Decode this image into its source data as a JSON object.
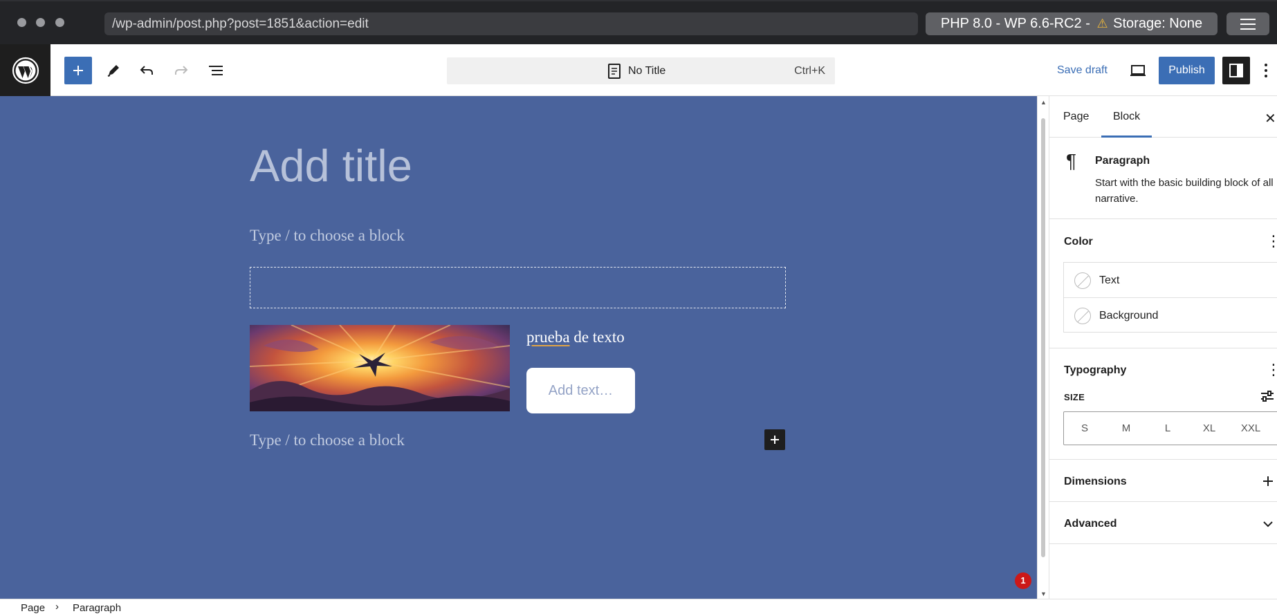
{
  "browser": {
    "url": "/wp-admin/post.php?post=1851&action=edit",
    "env_text": "PHP 8.0 - WP 6.6-RC2 -",
    "storage_text": "Storage: None"
  },
  "toolbar": {
    "command_title": "No Title",
    "command_shortcut": "Ctrl+K",
    "save_draft": "Save draft",
    "publish": "Publish"
  },
  "canvas": {
    "title_placeholder": "Add title",
    "block_placeholder_1": "Type / to choose a block",
    "media_text_word_1": "prueba",
    "media_text_rest": " de texto",
    "button_placeholder": "Add text…",
    "block_placeholder_2": "Type / to choose a block",
    "notice_count": "1"
  },
  "sidebar": {
    "tabs": [
      {
        "label": "Page"
      },
      {
        "label": "Block"
      }
    ],
    "block": {
      "name": "Paragraph",
      "description": "Start with the basic building block of all narrative."
    },
    "color": {
      "title": "Color",
      "items": [
        {
          "label": "Text"
        },
        {
          "label": "Background"
        }
      ]
    },
    "typography": {
      "title": "Typography",
      "size_label": "SIZE",
      "sizes": [
        "S",
        "M",
        "L",
        "XL",
        "XXL"
      ]
    },
    "dimensions_title": "Dimensions",
    "advanced_title": "Advanced"
  },
  "breadcrumb": {
    "items": [
      "Page",
      "Paragraph"
    ]
  },
  "colors": {
    "canvas_bg": "#4a639c",
    "accent": "#3b6eb5",
    "dark": "#1e1e1e",
    "notice": "#cc1818"
  }
}
